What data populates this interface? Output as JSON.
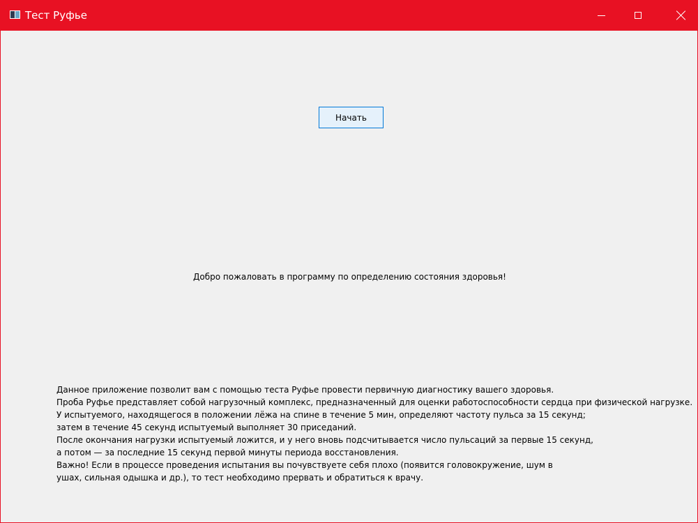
{
  "window": {
    "title": "Тест Руфье",
    "accent_color": "#e81123",
    "controls": {
      "minimize_icon": "minimize-icon",
      "maximize_icon": "maximize-icon",
      "close_icon": "close-icon"
    }
  },
  "main": {
    "start_button_label": "Начать",
    "welcome_text": "Добро пожаловать в программу по определению состояния здоровья!",
    "description_lines": [
      "Данное приложение позволит вам с помощью теста Руфье провести первичную диагностику вашего здоровья.",
      "Проба Руфье представляет собой нагрузочный комплекс, предназначенный для оценки работоспособности сердца при физической нагрузке.",
      "У испытуемого, находящегося в положении лёжа на спине в течение 5 мин, определяют частоту пульса за 15 секунд;",
      "затем в течение 45 секунд испытуемый выполняет 30 приседаний.",
      "После окончания нагрузки испытуемый ложится, и у него вновь подсчитывается число пульсаций за первые 15 секунд,",
      "а потом — за последние 15 секунд первой минуты периода восстановления.",
      "Важно! Если в процессе проведения испытания вы почувствуете себя плохо (появится головокружение, шум в",
      "ушах, сильная одышка и др.), то тест необходимо прервать и обратиться к врачу."
    ]
  }
}
